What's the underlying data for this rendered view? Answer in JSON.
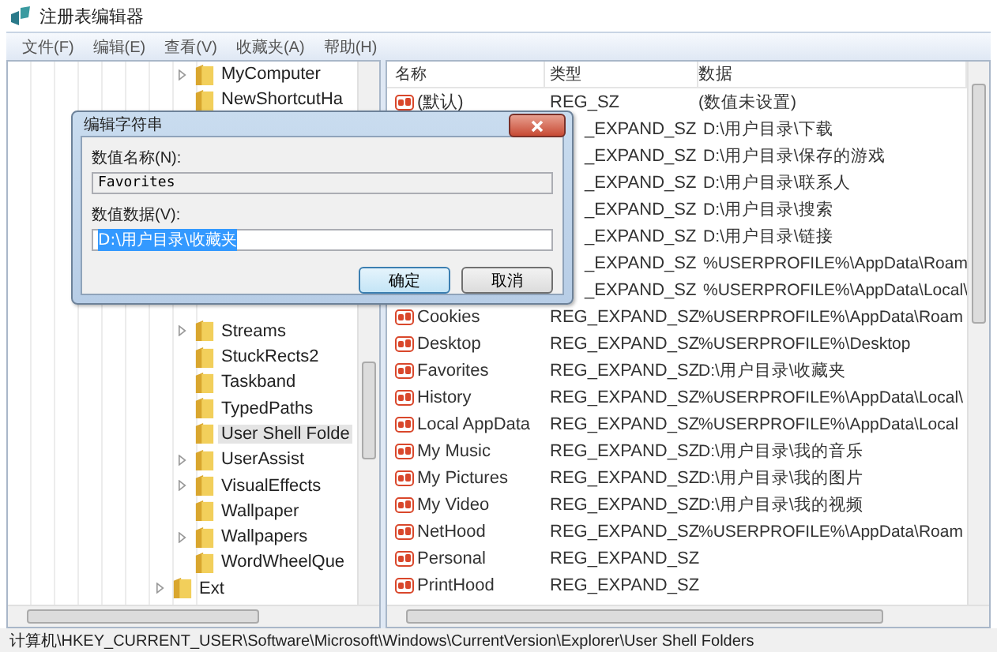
{
  "window": {
    "title": "注册表编辑器"
  },
  "menu": [
    "文件(F)",
    "编辑(E)",
    "查看(V)",
    "收藏夹(A)",
    "帮助(H)"
  ],
  "tree_items": [
    {
      "label": "MyComputer",
      "expandable": true,
      "selected": false
    },
    {
      "label": "NewShortcutHa",
      "expandable": false,
      "selected": false
    },
    {
      "label": "Streams",
      "expandable": true,
      "selected": false
    },
    {
      "label": "StuckRects2",
      "expandable": false,
      "selected": false
    },
    {
      "label": "Taskband",
      "expandable": false,
      "selected": false
    },
    {
      "label": "TypedPaths",
      "expandable": false,
      "selected": false
    },
    {
      "label": "User Shell Folde",
      "expandable": false,
      "selected": true
    },
    {
      "label": "UserAssist",
      "expandable": true,
      "selected": false
    },
    {
      "label": "VisualEffects",
      "expandable": true,
      "selected": false
    },
    {
      "label": "Wallpaper",
      "expandable": false,
      "selected": false
    },
    {
      "label": "Wallpapers",
      "expandable": true,
      "selected": false
    },
    {
      "label": "WordWheelQue",
      "expandable": false,
      "selected": false
    }
  ],
  "tree_outer_items": [
    {
      "label": "Ext",
      "expandable": true,
      "selected": false
    }
  ],
  "table": {
    "columns": [
      "名称",
      "类型",
      "数据"
    ],
    "rows": [
      {
        "name": "(默认)",
        "type": "REG_SZ",
        "data": "(数值未设置)"
      },
      {
        "type": "_EXPAND_SZ",
        "data": "D:\\用户目录\\下载"
      },
      {
        "type": "_EXPAND_SZ",
        "data": "D:\\用户目录\\保存的游戏"
      },
      {
        "type": "_EXPAND_SZ",
        "data": "D:\\用户目录\\联系人"
      },
      {
        "type": "_EXPAND_SZ",
        "data": "D:\\用户目录\\搜索"
      },
      {
        "type": "_EXPAND_SZ",
        "data": "D:\\用户目录\\链接"
      },
      {
        "type": "_EXPAND_SZ",
        "data": "%USERPROFILE%\\AppData\\Roam"
      },
      {
        "type": "_EXPAND_SZ",
        "data": "%USERPROFILE%\\AppData\\Local\\"
      },
      {
        "name": "Cookies",
        "type": "REG_EXPAND_SZ",
        "data": "%USERPROFILE%\\AppData\\Roam"
      },
      {
        "name": "Desktop",
        "type": "REG_EXPAND_SZ",
        "data": "%USERPROFILE%\\Desktop"
      },
      {
        "name": "Favorites",
        "type": "REG_EXPAND_SZ",
        "data": "D:\\用户目录\\收藏夹"
      },
      {
        "name": "History",
        "type": "REG_EXPAND_SZ",
        "data": "%USERPROFILE%\\AppData\\Local\\"
      },
      {
        "name": "Local AppData",
        "type": "REG_EXPAND_SZ",
        "data": "%USERPROFILE%\\AppData\\Local"
      },
      {
        "name": "My Music",
        "type": "REG_EXPAND_SZ",
        "data": "D:\\用户目录\\我的音乐"
      },
      {
        "name": "My Pictures",
        "type": "REG_EXPAND_SZ",
        "data": "D:\\用户目录\\我的图片"
      },
      {
        "name": "My Video",
        "type": "REG_EXPAND_SZ",
        "data": "D:\\用户目录\\我的视频"
      },
      {
        "name": "NetHood",
        "type": "REG_EXPAND_SZ",
        "data": "%USERPROFILE%\\AppData\\Roam"
      },
      {
        "name": "Personal",
        "type": "REG_EXPAND_SZ"
      },
      {
        "name": "PrintHood",
        "type": "REG_EXPAND_SZ"
      }
    ]
  },
  "dialog": {
    "title": "编辑字符串",
    "name_label": "数值名称(N):",
    "name_value": "Favorites",
    "data_label": "数值数据(V):",
    "data_value": "D:\\用户目录\\收藏夹",
    "buttons": [
      {
        "label": "确定",
        "default": true
      },
      {
        "label": "取消",
        "default": false
      }
    ]
  },
  "status_bar": "计算机\\HKEY_CURRENT_USER\\Software\\Microsoft\\Windows\\CurrentVersion\\Explorer\\User Shell Folders"
}
